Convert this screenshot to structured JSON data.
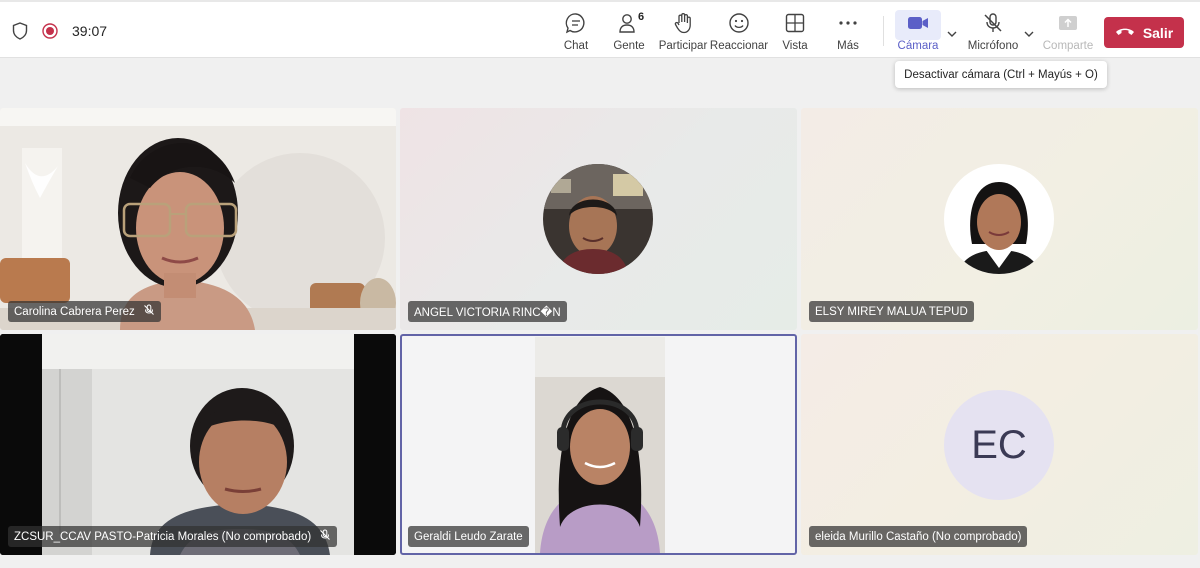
{
  "status": {
    "timer": "39:07"
  },
  "toolbar": {
    "chat": "Chat",
    "people": "Gente",
    "people_count": "6",
    "raise": "Participar",
    "react": "Reaccionar",
    "view": "Vista",
    "more": "Más",
    "camera": "Cámara",
    "mic": "Micrófono",
    "share": "Comparte",
    "leave": "Salir"
  },
  "tooltip": "Desactivar cámara (Ctrl + Mayús + O)",
  "participants": [
    {
      "name": "Carolina Cabrera Perez"
    },
    {
      "name": "ANGEL VICTORIA RINC�N"
    },
    {
      "name": "ELSY MIREY MALUA TEPUD"
    },
    {
      "name": "ZCSUR_CCAV PASTO-Patricia Morales (No comprobado)"
    },
    {
      "name": "Geraldi Leudo Zarate"
    },
    {
      "name": "eleida Murillo Castaño (No comprobado)",
      "initials": "EC"
    }
  ],
  "colors": {
    "accent": "#5b5fc7",
    "leave": "#c4314b",
    "active_border": "#6264a7"
  }
}
